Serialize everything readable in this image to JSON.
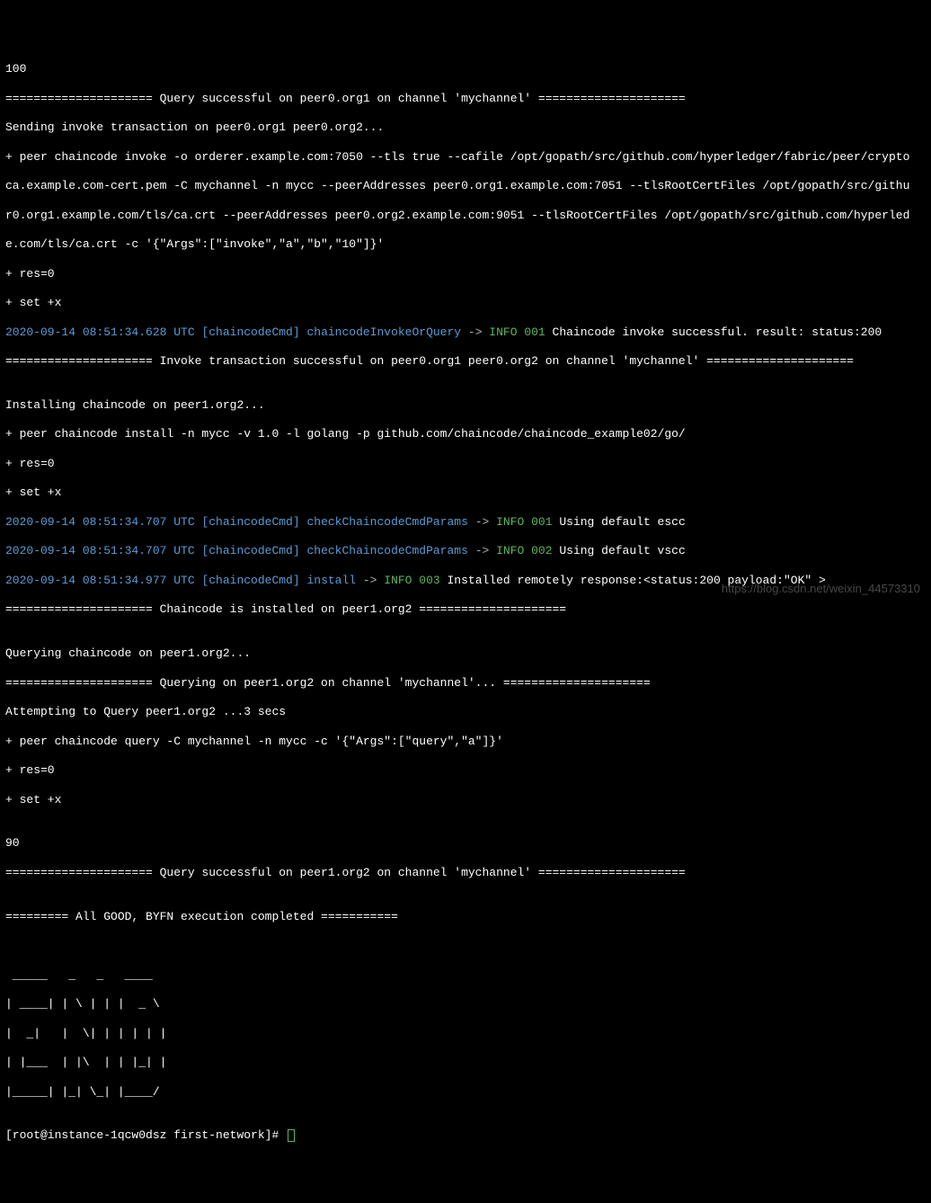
{
  "lines": {
    "l01": "100",
    "l02": "===================== Query successful on peer0.org1 on channel 'mychannel' =====================",
    "l03": "Sending invoke transaction on peer0.org1 peer0.org2...",
    "l04": "+ peer chaincode invoke -o orderer.example.com:7050 --tls true --cafile /opt/gopath/src/github.com/hyperledger/fabric/peer/crypto",
    "l05": "ca.example.com-cert.pem -C mychannel -n mycc --peerAddresses peer0.org1.example.com:7051 --tlsRootCertFiles /opt/gopath/src/githu",
    "l06": "r0.org1.example.com/tls/ca.crt --peerAddresses peer0.org2.example.com:9051 --tlsRootCertFiles /opt/gopath/src/github.com/hyperled",
    "l07": "e.com/tls/ca.crt -c '{\"Args\":[\"invoke\",\"a\",\"b\",\"10\"]}'",
    "l08": "+ res=0",
    "l09": "+ set +x",
    "l10_ts": "2020-09-14 08:51:34.628 UTC",
    "l10_ctx": " [chaincodeCmd] chaincodeInvokeOrQuery ",
    "l10_arrow": "-> ",
    "l10_info": "INFO 001",
    "l10_rest": " Chaincode invoke successful. result: status:200",
    "l11": "===================== Invoke transaction successful on peer0.org1 peer0.org2 on channel 'mychannel' =====================",
    "l12": "",
    "l13": "Installing chaincode on peer1.org2...",
    "l14": "+ peer chaincode install -n mycc -v 1.0 -l golang -p github.com/chaincode/chaincode_example02/go/",
    "l15": "+ res=0",
    "l16": "+ set +x",
    "l17_ts": "2020-09-14 08:51:34.707 UTC",
    "l17_ctx": " [chaincodeCmd] checkChaincodeCmdParams ",
    "l17_arrow": "-> ",
    "l17_info": "INFO 001",
    "l17_rest": " Using default escc",
    "l18_ts": "2020-09-14 08:51:34.707 UTC",
    "l18_ctx": " [chaincodeCmd] checkChaincodeCmdParams ",
    "l18_arrow": "-> ",
    "l18_info": "INFO 002",
    "l18_rest": " Using default vscc",
    "l19_ts": "2020-09-14 08:51:34.977 UTC",
    "l19_ctx": " [chaincodeCmd] install ",
    "l19_arrow": "-> ",
    "l19_info": "INFO 003",
    "l19_rest": " Installed remotely response:<status:200 payload:\"OK\" >",
    "l20": "===================== Chaincode is installed on peer1.org2 =====================",
    "l21": "",
    "l22": "Querying chaincode on peer1.org2...",
    "l23": "===================== Querying on peer1.org2 on channel 'mychannel'... =====================",
    "l24": "Attempting to Query peer1.org2 ...3 secs",
    "l25": "+ peer chaincode query -C mychannel -n mycc -c '{\"Args\":[\"query\",\"a\"]}'",
    "l26": "+ res=0",
    "l27": "+ set +x",
    "l28": "",
    "l29": "90",
    "l30": "===================== Query successful on peer1.org2 on channel 'mychannel' =====================",
    "l31": "",
    "l32": "========= All GOOD, BYFN execution completed ===========",
    "l33": "",
    "l34": "",
    "art1": " _____   _   _   ____",
    "art2": "| ____| | \\ | | |  _ \\",
    "art3": "|  _|   |  \\| | | | | |",
    "art4": "| |___  | |\\  | | |_| |",
    "art5": "|_____| |_| \\_| |____/",
    "l40": "",
    "prompt": "[root@instance-1qcw0dsz first-network]# "
  },
  "watermark": "https://blog.csdn.net/weixin_44573310"
}
